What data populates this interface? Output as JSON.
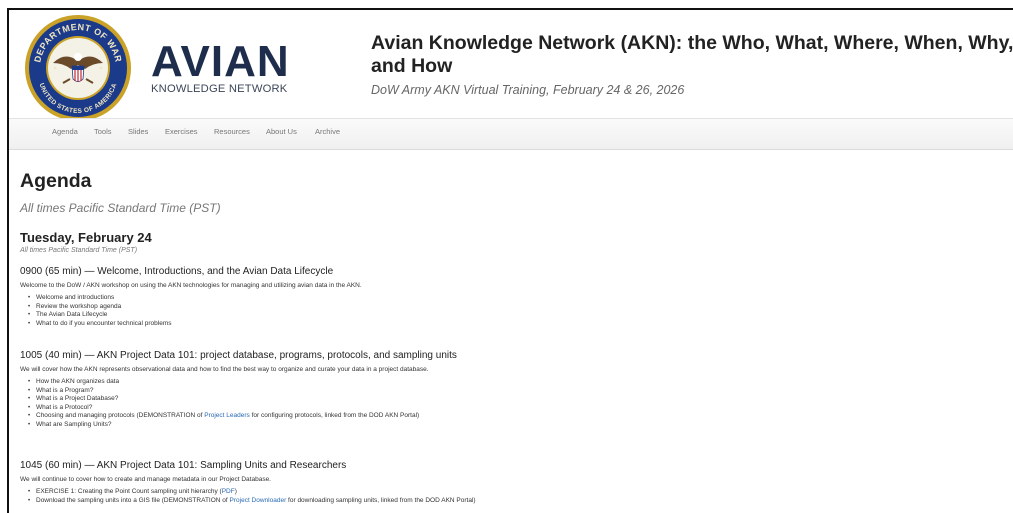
{
  "header": {
    "seal": {
      "top_text": "DEPARTMENT OF WAR",
      "bottom_text": "UNITED STATES OF AMERICA"
    },
    "logo": {
      "word": "AVIAN",
      "tagline": "KNOWLEDGE NETWORK"
    },
    "title": "Avian Knowledge Network (AKN): the Who, What, Where, When, Why, and How",
    "subtitle": "DoW Army AKN Virtual Training, February 24 & 26, 2026"
  },
  "nav": {
    "items": [
      "Agenda",
      "Tools",
      "Slides",
      "Exercises",
      "Resources",
      "About Us",
      "Archive"
    ]
  },
  "page": {
    "title": "Agenda",
    "subtitle": "All times Pacific Standard Time (PST)"
  },
  "day": {
    "title": "Tuesday, February 24",
    "subtitle": "All times Pacific Standard Time (PST)"
  },
  "sessions": [
    {
      "title": "0900 (65 min) — Welcome, Introductions, and the Avian Data Lifecycle",
      "description": "Welcome to the DoW / AKN workshop on using the AKN technologies for managing and utilizing avian data in the AKN.",
      "items": [
        "Welcome and introductions",
        "Review the workshop agenda",
        "The Avian Data Lifecycle",
        "What to do if you encounter technical problems"
      ]
    },
    {
      "title": "1005 (40 min) — AKN Project Data 101: project database, programs, protocols, and sampling units",
      "description": "We will cover how the AKN represents observational data and how to find the best way to organize and curate your data in a project database.",
      "items": [
        "How the AKN organizes data",
        "What is a Program?",
        "What is a Project Database?",
        "What is a Protocol?"
      ],
      "item_with_link": {
        "before": "Choosing and managing protocols (DEMONSTRATION of ",
        "link": "Project Leaders",
        "after": " for configuring protocols, linked from the DOD AKN Portal)"
      },
      "last_item": "What are Sampling Units?"
    },
    {
      "title": "1045 (60 min) — AKN Project Data 101: Sampling Units and Researchers",
      "description": "We will continue to cover how to create and manage metadata in our Project Database.",
      "exercise": {
        "before": "EXERCISE 1: Creating the Point Count sampling unit hierarchy (",
        "link": "PDF",
        "after": ")"
      },
      "download": {
        "before": "Download the sampling units into a GIS file (DEMONSTRATION of ",
        "link": "Project Downloader",
        "after": " for downloading sampling units, linked from the DOD AKN Portal)"
      }
    }
  ],
  "colors": {
    "seal_blue": "#1b3a8a",
    "seal_gold": "#c9a227",
    "logo_navy": "#1f2d4d",
    "link": "#2a6ab3"
  }
}
